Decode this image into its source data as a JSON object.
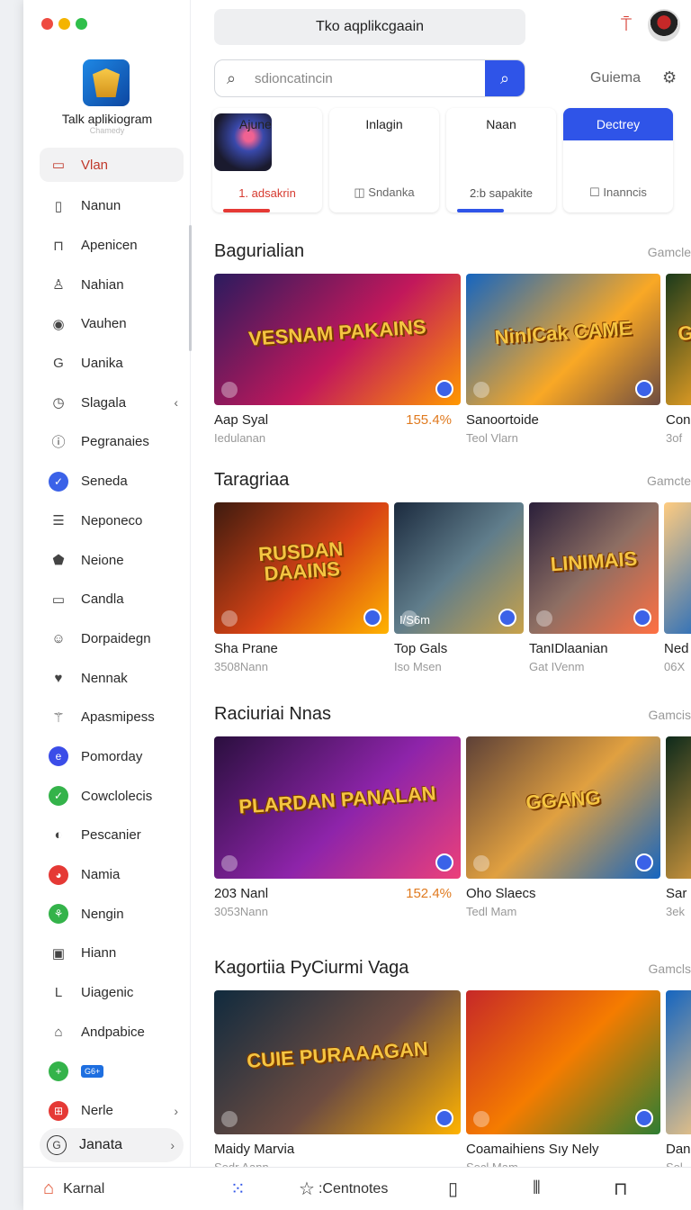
{
  "window": {
    "controls": [
      "#ee4b41",
      "#f4b400",
      "#2fbf4a"
    ]
  },
  "sidebar": {
    "app_name": "Talk aplikiogram",
    "app_sub": "Chamedy",
    "items": [
      {
        "label": "Vlan",
        "icon": "calendar-icon",
        "active": true
      },
      {
        "label": "Nanun",
        "icon": "bookmark-icon"
      },
      {
        "label": "Apenicen",
        "icon": "lock-icon"
      },
      {
        "label": "Nahian",
        "icon": "user-icon"
      },
      {
        "label": "Vauhen",
        "icon": "circle-icon"
      },
      {
        "label": "Uanika",
        "icon": "g-icon"
      },
      {
        "label": "Slagala",
        "icon": "clock-icon",
        "chevron": "‹"
      },
      {
        "label": "Pegranaies",
        "icon": "info-icon"
      },
      {
        "label": "Seneda",
        "icon": "check-circle-icon",
        "color": "#3b62e8"
      },
      {
        "label": "Neponeco",
        "icon": "list-icon"
      },
      {
        "label": "Neione",
        "icon": "tag-icon"
      },
      {
        "label": "Candla",
        "icon": "box-icon"
      },
      {
        "label": "Dorpaidegn",
        "icon": "smile-icon"
      },
      {
        "label": "Nennak",
        "icon": "heart-icon"
      },
      {
        "label": "Apasmipess",
        "icon": "wand-icon"
      },
      {
        "label": "Pomorday",
        "icon": "e-circle-icon",
        "color": "#3b4de8"
      },
      {
        "label": "Cowclolecis",
        "icon": "leaf-circle-icon",
        "color": "#34b34a"
      },
      {
        "label": "Pescanier",
        "icon": "shell-icon"
      },
      {
        "label": "Namia",
        "icon": "chrome-icon",
        "color": "#e53935"
      },
      {
        "label": "Nengin",
        "icon": "plant-circle-icon",
        "color": "#34b34a"
      },
      {
        "label": "Hiann",
        "icon": "square-icon"
      },
      {
        "label": "Uiagenic",
        "icon": "l-square-icon"
      },
      {
        "label": "Andpabice",
        "icon": "home-icon"
      },
      {
        "label": "",
        "icon": "plus-circle-icon",
        "color": "#34b34a",
        "badge": "G6+"
      },
      {
        "label": "Nerle",
        "icon": "grid-square-icon",
        "color": "#e53935",
        "chevron": "›"
      }
    ],
    "footer": {
      "label": "Janata",
      "icon": "g-circle-icon",
      "chevron": "›"
    }
  },
  "header": {
    "title": "Tko aqplikcgaain",
    "search_placeholder": "sdioncatincin",
    "guest": "Guiema"
  },
  "tabs": [
    {
      "label": "Ajune",
      "sub": "1. adsakrin",
      "underline": "#e53935"
    },
    {
      "label": "Inlagin",
      "sub": "◫ Sndanka"
    },
    {
      "label": "Naan",
      "sub": "2:b sapakite",
      "underline": "#2f54e8"
    },
    {
      "label": "Dectrey",
      "sub": "☐ Inanncis",
      "active": true
    }
  ],
  "sections": [
    {
      "title": "Bagurialian",
      "more": "Gamcle",
      "cards": [
        {
          "art": "VESNAM PAKAINS",
          "name": "Aap Syal",
          "sub": "Iedulanan",
          "price": "155.4%"
        },
        {
          "art": "NinICak CAME",
          "name": "Sanoortoide",
          "sub": "Teol Vlarn"
        },
        {
          "art": "GR",
          "name": "Con",
          "sub": "3of"
        }
      ]
    },
    {
      "title": "Taragriaa",
      "more": "Gamcte",
      "cards": [
        {
          "art": "RUSDAN DAAINS",
          "name": "Sha Prane",
          "sub": "3508Nann"
        },
        {
          "art": "",
          "name": "Top Gals",
          "sub": "Iso Msen",
          "overlay": "I/S6m"
        },
        {
          "art": "LINIMAIS",
          "name": "TanIDlaanian",
          "sub": "Gat IVenm"
        },
        {
          "art": "",
          "name": "Ned",
          "sub": "06X"
        }
      ]
    },
    {
      "title": "Raciuriai Nnas",
      "more": "Gamcis",
      "cards": [
        {
          "art": "PLARDAN PANALAN",
          "name": "203 Nanl",
          "sub": "3053Nann",
          "price": "152.4%"
        },
        {
          "art": "GGANG",
          "name": "Oho Slaecs",
          "sub": "Tedl Mam"
        },
        {
          "art": "",
          "name": "Sar",
          "sub": "3ek"
        }
      ]
    },
    {
      "title": "Kagortiia PyCiurmi Vaga",
      "more": "Gamcls",
      "cards": [
        {
          "art": "CUIE PURAAAGAN",
          "name": "Maidy Marvia",
          "sub": "Sedr Aann"
        },
        {
          "art": "",
          "name": "Coamaihiens Sıy Nely",
          "sub": "Secl Mam"
        },
        {
          "art": "",
          "name": "Dan",
          "sub": "Sol"
        }
      ]
    }
  ],
  "bottom": {
    "home_label": "Karnal",
    "mid_label": ":Centnotes"
  }
}
